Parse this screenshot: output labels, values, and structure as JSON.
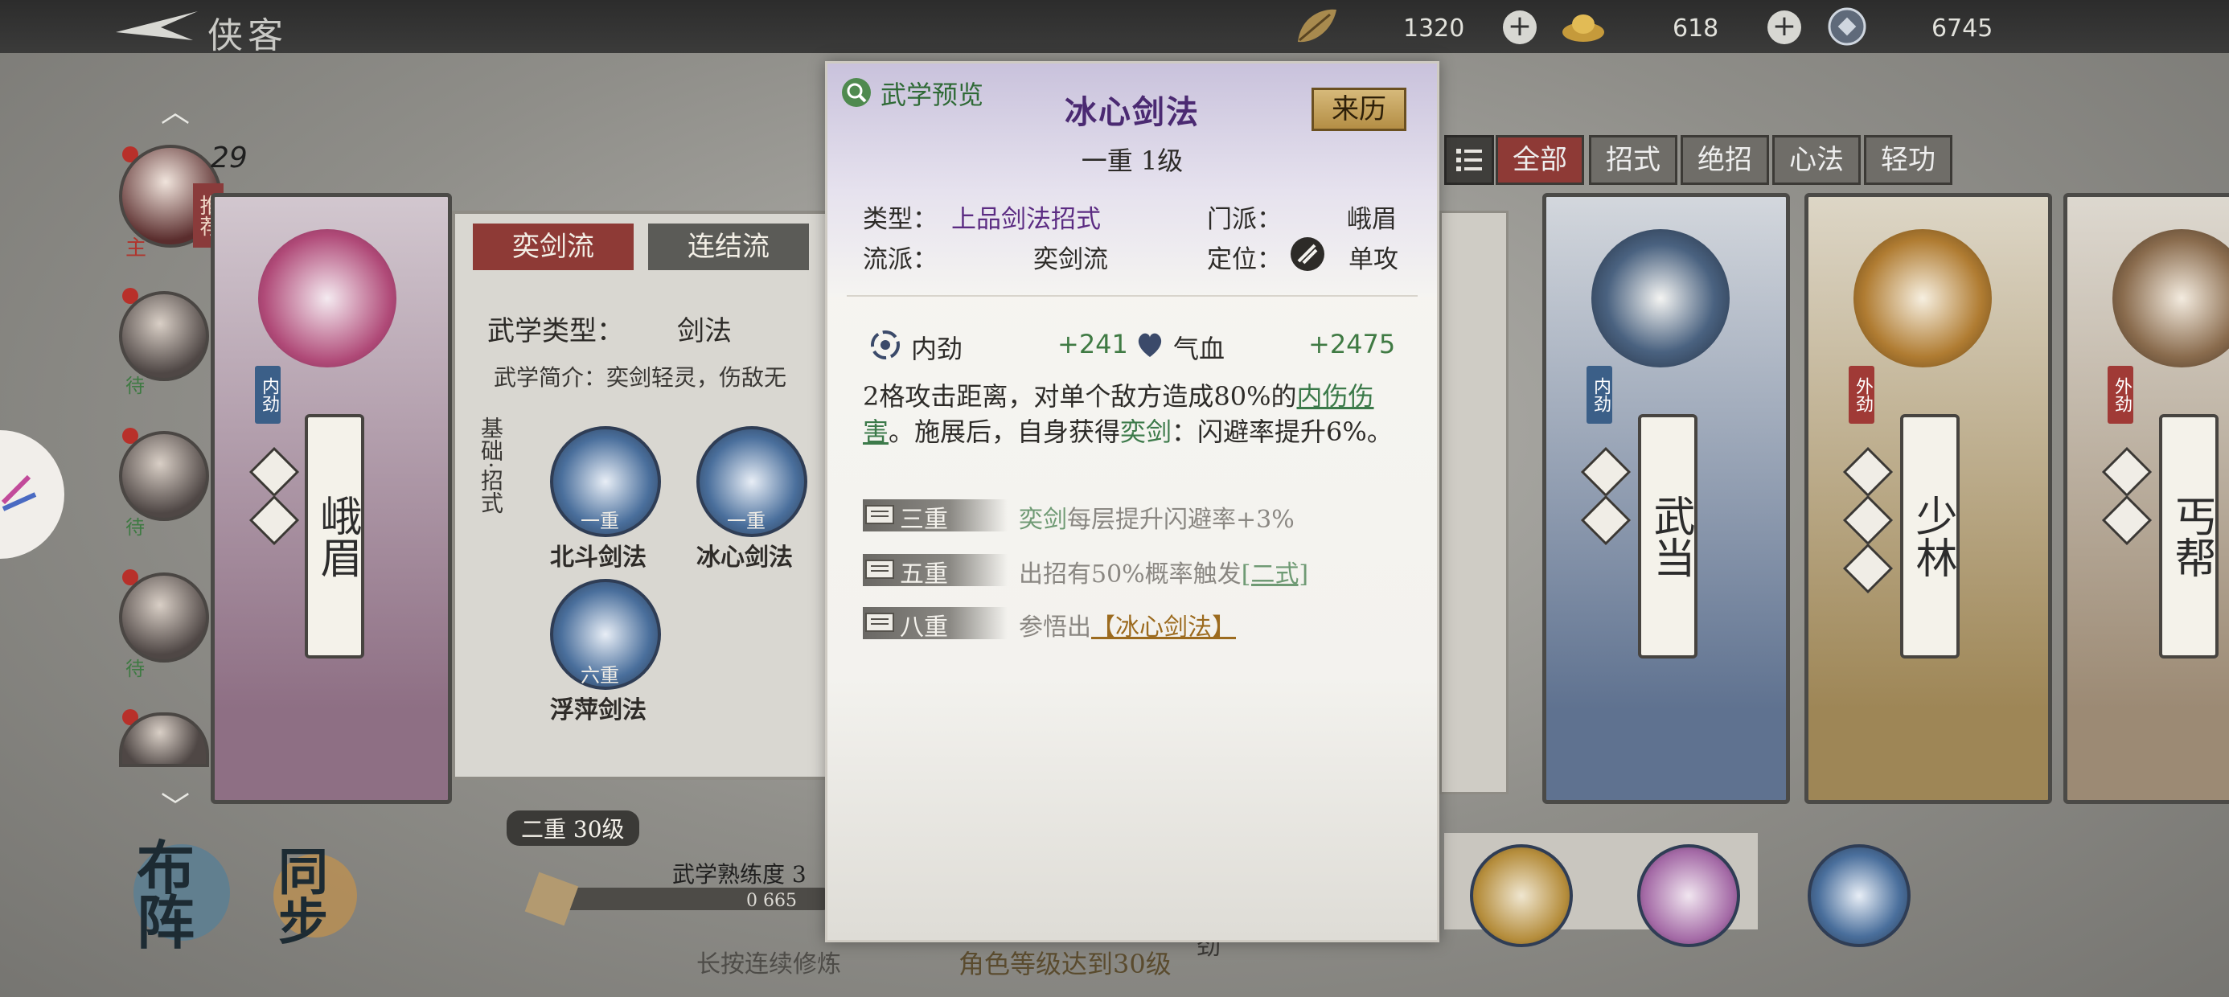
{
  "topbar": {
    "title": "侠客",
    "resources": [
      {
        "icon": "leaf-icon",
        "value": "1320"
      },
      {
        "icon": "gold-ingot-icon",
        "value": "618"
      },
      {
        "icon": "coin-icon",
        "value": "6745"
      }
    ]
  },
  "roster": {
    "first_level": "29",
    "first_badges": {
      "recommend": "推荐",
      "main": "主"
    },
    "badge_other": "待",
    "buttons": {
      "formation": "布阵",
      "sync": "同步"
    }
  },
  "sects": [
    {
      "name": "峨眉",
      "tag": "内劲"
    },
    {
      "name": "武当",
      "tag": "内劲"
    },
    {
      "name": "少林",
      "tag": "外劲"
    },
    {
      "name": "丐帮",
      "tag": "外劲"
    }
  ],
  "panel": {
    "flow_tabs": [
      "奕剑流",
      "连结流"
    ],
    "type_label": "武学类型：",
    "type_value": "剑法",
    "intro": "武学简介：奕剑轻灵，伤敌无",
    "section_label": "基础·招式",
    "skills": [
      {
        "name": "北斗剑法",
        "rank": "一重"
      },
      {
        "name": "冰心剑法",
        "rank": "一重"
      },
      {
        "name": "浮萍剑法",
        "rank": "六重"
      }
    ],
    "bottom_rank": "二重 30级",
    "proficiency_label": "武学熟练度 3",
    "proficiency_value": "0 665",
    "hold_hint": "长按连续修炼",
    "cut_text": "劲"
  },
  "filter_tabs": [
    "全部",
    "招式",
    "绝招",
    "心法",
    "轻功"
  ],
  "modal": {
    "preview_label": "武学预览",
    "skill_name": "冰心剑法",
    "origin_button": "来历",
    "rank_level": "一重 1级",
    "type_label": "类型：",
    "type_value": "上品剑法招式",
    "sect_label": "门派：",
    "sect_value": "峨眉",
    "flow_label": "流派：",
    "flow_value": "奕剑流",
    "position_label": "定位：",
    "position_value": "单攻",
    "stats": [
      {
        "icon": "swirl-icon",
        "name": "内劲",
        "value": "+241"
      },
      {
        "icon": "heart-icon",
        "name": "气血",
        "value": "+2475"
      }
    ],
    "description": {
      "p1": "2格攻击距离，对单个敌方造成80%的",
      "p1_highlight": "内伤伤害",
      "p2": "。施展后，自身获得",
      "p2_highlight": "奕剑",
      "p3": "：闪避率提升6%。"
    },
    "tiers": [
      {
        "label": "三重",
        "highlight": "奕剑",
        "text": "每层提升闪避率+3%"
      },
      {
        "label": "五重",
        "text": "出招有50%概率触发",
        "link": "[二式]"
      },
      {
        "label": "八重",
        "text": "参悟出",
        "link": "【冰心剑法】"
      }
    ],
    "footer": "角色等级达到30级"
  },
  "colors": {
    "accent_purple": "#5b2b82",
    "link_green": "#3c7a4a",
    "gold": "#9c6b1f",
    "stat_green": "#3f7a43"
  }
}
